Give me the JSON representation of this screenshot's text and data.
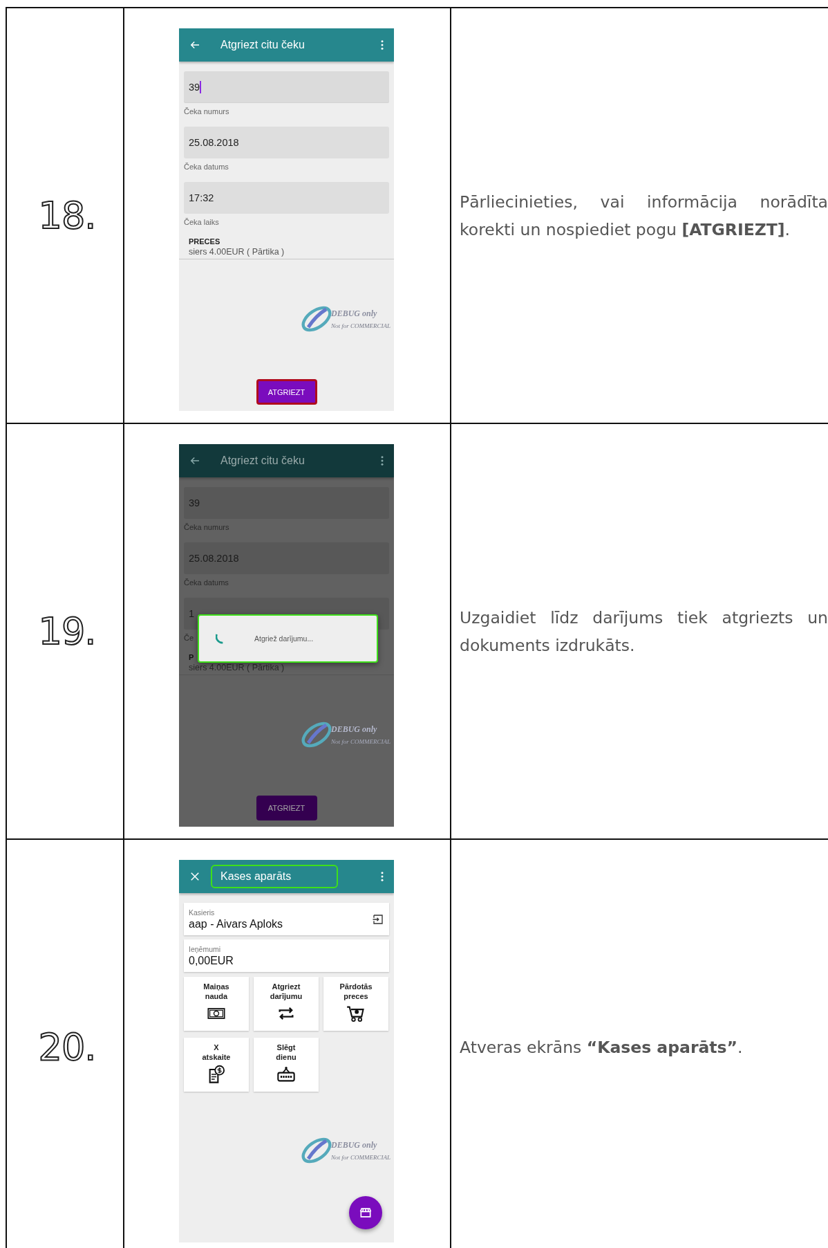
{
  "steps": [
    {
      "number": "18.",
      "screen": {
        "kind": "form",
        "dimmed": false,
        "title": "Atgriezt citu čeku",
        "title_highlighted": false,
        "fields": [
          {
            "value": "39",
            "label": "Čeka numurs",
            "focused": true
          },
          {
            "value": "25.08.2018",
            "label": "Čeka datums",
            "focused": false
          },
          {
            "value": "17:32",
            "label": "Čeka laiks",
            "focused": false
          }
        ],
        "section": "PRECES",
        "items": [
          "siers 4.00EUR ( Pārtika )"
        ],
        "watermark": {
          "title": "DEBUG only",
          "subtitle": "Not for COMMERCIAL"
        },
        "button": {
          "label": "ATGRIEZT",
          "highlighted": true
        }
      },
      "instruction": "Pārliecinieties, vai informācija norādīta korekti un nospiediet pogu **[ATGRIEZT]**."
    },
    {
      "number": "19.",
      "screen": {
        "kind": "form",
        "dimmed": true,
        "title": "Atgriezt citu čeku",
        "title_highlighted": false,
        "fields": [
          {
            "value": "39",
            "label": "Čeka numurs",
            "focused": false
          },
          {
            "value": "25.08.2018",
            "label": "Čeka datums",
            "focused": false
          },
          {
            "value": "1",
            "label": "Če",
            "focused": false
          }
        ],
        "section": "P",
        "items": [
          "siers 4.00EUR ( Pārtika )"
        ],
        "watermark": {
          "title": "DEBUG only",
          "subtitle": "Not for COMMERCIAL"
        },
        "button": {
          "label": "ATGRIEZT",
          "highlighted": false
        },
        "dialog": {
          "text": "Atgriež darījumu...",
          "highlighted": true
        }
      },
      "instruction": "Uzgaidiet līdz darījums tiek atgriezts un dokuments izdrukāts."
    },
    {
      "number": "20.",
      "screen": {
        "kind": "dashboard",
        "dimmed": false,
        "title": "Kases aparāts",
        "title_highlighted": true,
        "cards": [
          {
            "label": "Kasieris",
            "value": "aap - Aivars Aploks",
            "action": true
          },
          {
            "label": "Ieņēmumi",
            "value": "0,00EUR",
            "action": false
          }
        ],
        "tiles": [
          "Maiņas\nnauda",
          "Atgriezt\ndarījumu",
          "Pārdotās\npreces",
          "X\natskaite",
          "Slēgt\ndienu"
        ],
        "watermark": {
          "title": "DEBUG only",
          "subtitle": "Not for COMMERCIAL"
        }
      },
      "instruction": "Atveras ekrāns **“Kases aparāts”**."
    }
  ]
}
